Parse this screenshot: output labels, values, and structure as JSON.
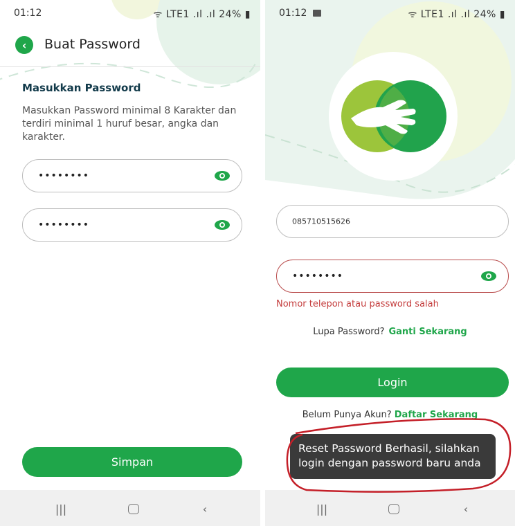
{
  "colors": {
    "accent": "#1fa64a",
    "error": "#c43c3c",
    "toast_bg": "#3a3a3a",
    "annotation": "#c41f28"
  },
  "status_bar": {
    "time": "01:12",
    "indicators": "ᯤ LTE1 .ıl .ıl",
    "battery": "24%"
  },
  "create_password": {
    "title": "Buat Password",
    "section_title": "Masukkan Password",
    "description": "Masukkan Password minimal 8 Karakter dan terdiri minimal 1 huruf besar, angka dan karakter.",
    "password_value": "••••••••",
    "confirm_value": "••••••••",
    "save_label": "Simpan"
  },
  "login": {
    "phone_value": "085710515626",
    "password_value": "••••••••",
    "error_message": "Nomor telepon atau password salah",
    "forgot_text": "Lupa Password?",
    "forgot_link": "Ganti Sekarang",
    "login_label": "Login",
    "signup_text": "Belum Punya Akun?",
    "signup_link": "Daftar Sekarang",
    "toast": "Reset Password Berhasil, silahkan login dengan password baru anda"
  },
  "icons": {
    "back": "chevron-left-icon",
    "eye": "eye-icon",
    "recent": "recent-apps-icon",
    "home": "home-icon",
    "nav_back": "back-icon",
    "logo": "handshake-logo-icon",
    "gallery": "image-icon",
    "battery": "battery-icon"
  }
}
